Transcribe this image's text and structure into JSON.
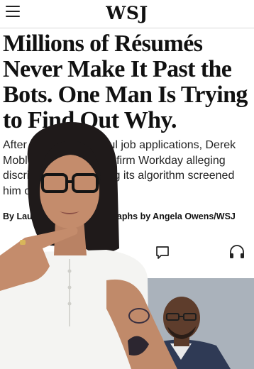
{
  "header": {
    "logo": "WSJ",
    "menu_icon": "hamburger-menu-icon"
  },
  "article": {
    "headline": "Millions of Résumés Never Make It Past the Bots. One Man Is Trying to Find Out Why.",
    "dek": "After 100 unsuccessful job applications, Derek Mobley sued software firm Workday alleging discrimination, claiming its algorithm screened him out",
    "byline": "By Lauren Weber | Photographs by Angela Owens/WSJ",
    "actions": {
      "comment_icon": "comment-icon",
      "audio_icon": "headphones-icon"
    }
  },
  "colors": {
    "background": "#ffffff",
    "text": "#111111",
    "divider": "#d8d8d8"
  }
}
